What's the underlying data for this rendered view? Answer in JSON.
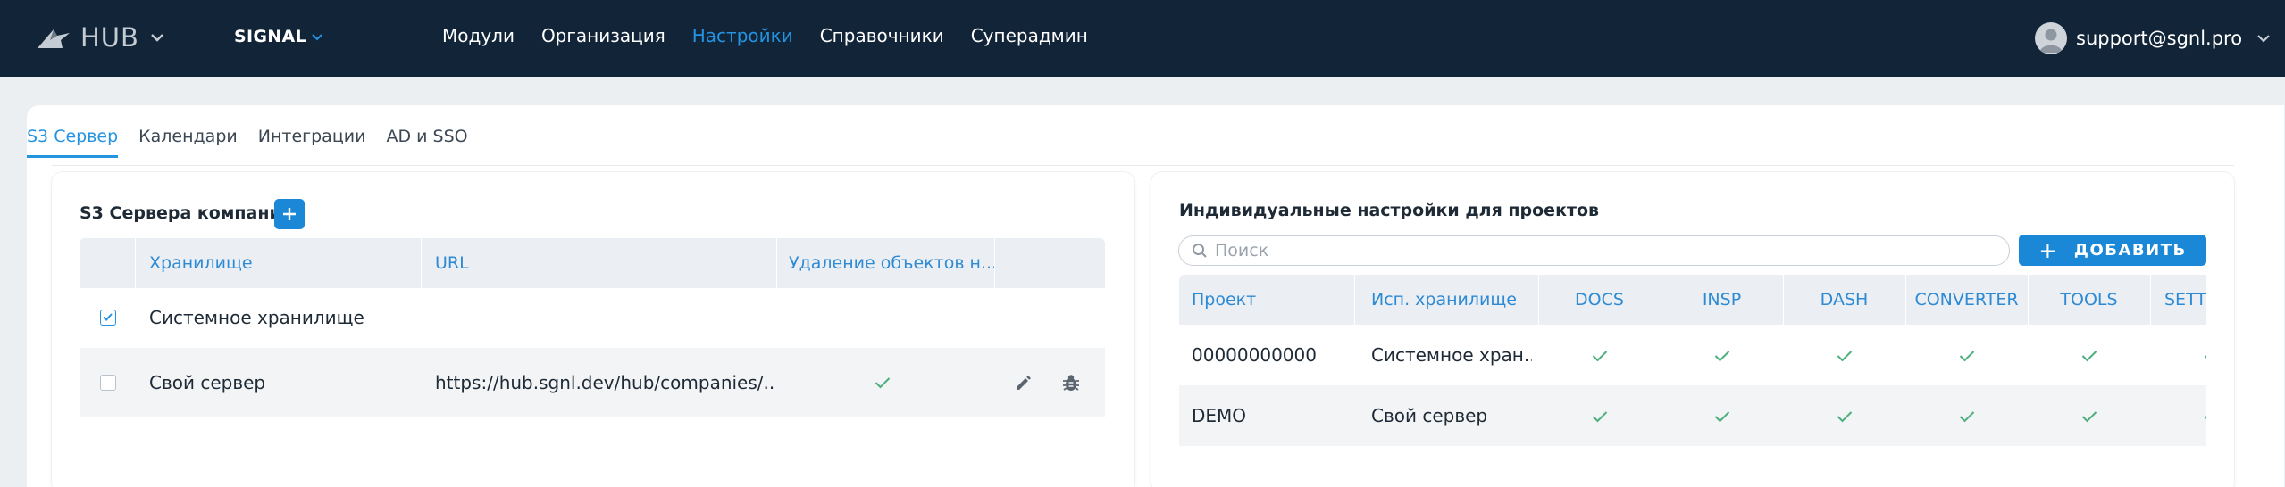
{
  "app": {
    "brand": "HUB",
    "organization": "SIGNAL",
    "nav": [
      {
        "label": "Модули",
        "active": false
      },
      {
        "label": "Организация",
        "active": false
      },
      {
        "label": "Настройки",
        "active": true
      },
      {
        "label": "Справочники",
        "active": false
      },
      {
        "label": "Суперадмин",
        "active": false
      }
    ],
    "user": "support@sgnl.pro",
    "accent": "#2493e0",
    "topbar_color": "#122437"
  },
  "tabs": [
    {
      "label": "S3 Сервер",
      "active": true
    },
    {
      "label": "Календари",
      "active": false
    },
    {
      "label": "Интеграции",
      "active": false
    },
    {
      "label": "AD и SSO",
      "active": false
    }
  ],
  "s3": {
    "title": "S3 Сервера компании",
    "columns": [
      "Хранилище",
      "URL",
      "Удаление объектов н..."
    ],
    "rows": [
      {
        "checked": true,
        "name": "Системное хранилище",
        "url": "",
        "delete_objects": false,
        "actions": []
      },
      {
        "checked": false,
        "name": "Свой сервер",
        "url": "https://hub.sgnl.dev/hub/companies/...",
        "delete_objects": true,
        "actions": [
          "edit-icon",
          "bug-icon"
        ]
      }
    ]
  },
  "projects": {
    "title": "Индивидуальные настройки для проектов",
    "search_placeholder": "Поиск",
    "add_label": "ДОБАВИТЬ",
    "columns": [
      "Проект",
      "Исп. хранилище",
      "DOCS",
      "INSP",
      "DASH",
      "CONVERTER",
      "TOOLS",
      "SETT"
    ],
    "rows": [
      {
        "project": "00000000000",
        "storage": "Системное хран...",
        "flags": [
          true,
          true,
          true,
          true,
          true,
          true
        ]
      },
      {
        "project": "DEMO",
        "storage": "Свой сервер",
        "flags": [
          true,
          true,
          true,
          true,
          true,
          true
        ]
      }
    ]
  }
}
